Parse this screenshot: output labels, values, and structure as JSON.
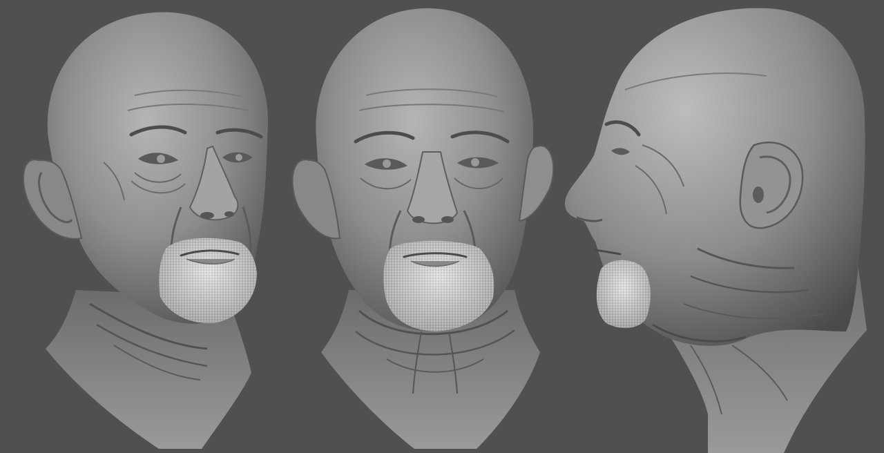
{
  "scene": {
    "background_color": "#505050",
    "material_color": "#8a8a8a",
    "highlight_color": "#b8b8b8",
    "shadow_color": "#3c3c3c",
    "beard_color": "#d8d8d8"
  },
  "views": [
    {
      "id": "three-quarter",
      "facing": "right"
    },
    {
      "id": "front",
      "facing": "viewer"
    },
    {
      "id": "profile",
      "facing": "left"
    }
  ]
}
